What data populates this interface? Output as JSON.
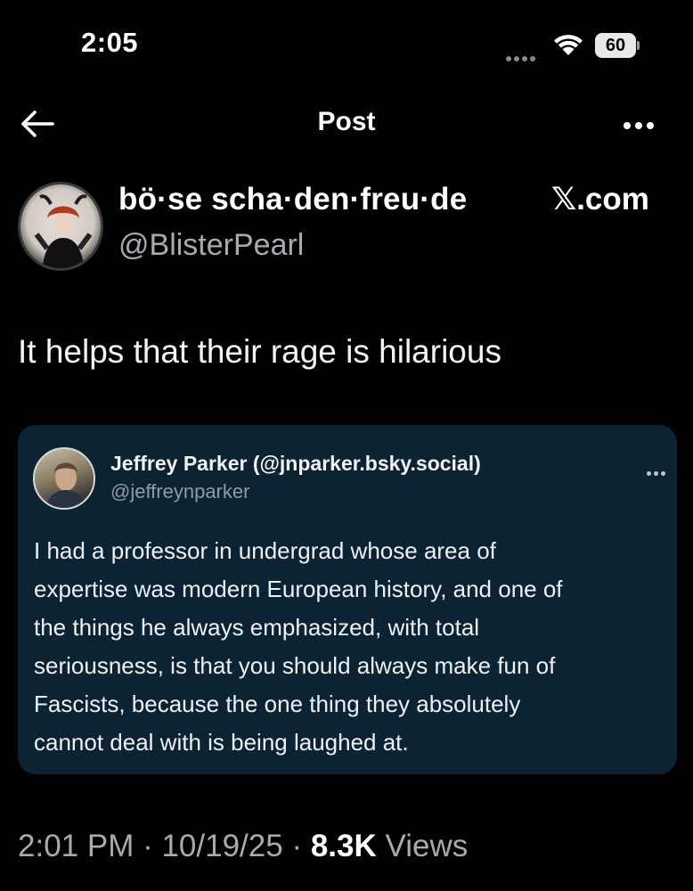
{
  "status_bar": {
    "time": "2:05",
    "battery_level": "60"
  },
  "nav": {
    "title": "Post"
  },
  "author": {
    "display_name": "bö·se scha·den·freu·de",
    "handle": "@BlisterPearl",
    "site_badge": "𝕏.com"
  },
  "post": {
    "text": "It helps that their rage is hilarious"
  },
  "quote": {
    "name": "Jeffrey Parker (@jnparker.bsky.social)",
    "handle": "@jeffreynparker",
    "lines": [
      "I had a professor in undergrad whose area of",
      "expertise was modern European history, and one of",
      "the things he always emphasized, with total",
      "seriousness, is that you should always make fun of",
      "Fascists, because the one thing they absolutely",
      "cannot deal with is being laughed at."
    ]
  },
  "meta": {
    "time": "2:01 PM",
    "separator": " · ",
    "date": "10/19/25",
    "views_count": "8.3K",
    "views_label": "Views"
  },
  "colors": {
    "background": "#000000",
    "quote_card": "#0c2333",
    "secondary_text": "#a7abb0"
  },
  "icons": [
    "back-arrow-icon",
    "more-horizontal-icon",
    "wifi-icon",
    "battery-icon",
    "cellular-signal-icon"
  ]
}
